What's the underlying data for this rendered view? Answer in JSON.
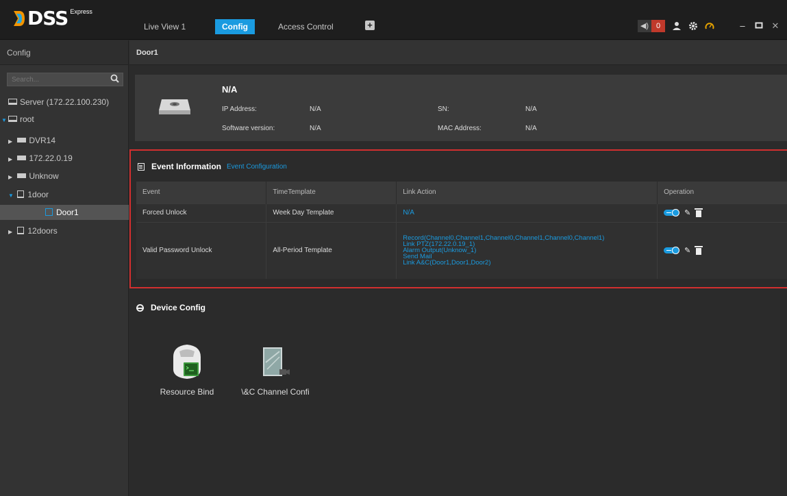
{
  "app": {
    "brand": "DSS",
    "brand_sup": "Express",
    "tabs": [
      {
        "label": "Live View 1"
      },
      {
        "label": "Config"
      },
      {
        "label": "Access Control"
      }
    ],
    "alarm_count": "0"
  },
  "left": {
    "title": "Config",
    "search_placeholder": "Search...",
    "tree": [
      {
        "label": "Server (172.22.100.230)"
      },
      {
        "label": "root"
      },
      {
        "label": "DVR14"
      },
      {
        "label": "172.22.0.19"
      },
      {
        "label": "Unknow"
      },
      {
        "label": "1door"
      },
      {
        "label": "Door1"
      },
      {
        "label": "12doors"
      }
    ]
  },
  "main": {
    "breadcrumb": "Door1",
    "device": {
      "name": "N/A",
      "ip_label": "IP Address:",
      "ip_value": "N/A",
      "sn_label": "SN:",
      "sn_value": "N/A",
      "sw_label": "Software version:",
      "sw_value": "N/A",
      "mac_label": "MAC Address:",
      "mac_value": "N/A"
    },
    "event": {
      "title": "Event Information",
      "config_link": "Event Configuration",
      "columns": [
        "Event",
        "TimeTemplate",
        "Link Action",
        "Operation"
      ],
      "rows": [
        {
          "event": "Forced Unlock",
          "template": "Week Day Template",
          "actions": [
            "N/A"
          ]
        },
        {
          "event": "Valid Password Unlock",
          "template": "All-Period Template",
          "actions": [
            "Record(Channel0,Channel1,Channel0,Channel1,Channel0,Channel1)",
            "Link PTZ(172.22.0.19_1)",
            "Alarm Output(Unknow_1)",
            "Send Mail",
            "Link A&C(Door1,Door1,Door2)"
          ]
        }
      ]
    },
    "device_config": {
      "title": "Device Config",
      "tiles": [
        {
          "label": "Resource Bind"
        },
        {
          "label": "\\&C Channel Confi"
        }
      ]
    }
  },
  "colors": {
    "accent": "#1a9be0",
    "highlight_border": "#d32f2f",
    "background": "#2b2b2b"
  }
}
